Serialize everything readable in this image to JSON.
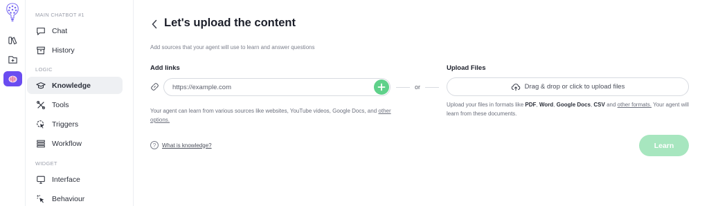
{
  "rail": {
    "icons": [
      "brain-logo-icon",
      "library-icon",
      "new-chatbot-icon",
      "brain-icon"
    ],
    "accent": "#6a4cf0"
  },
  "sidebar": {
    "section_main": "MAIN CHATBOT #1",
    "section_logic": "LOGIC",
    "section_widget": "WIDGET",
    "items": [
      {
        "label": "Chat",
        "icon": "chat-bubble-icon",
        "active": false
      },
      {
        "label": "History",
        "icon": "archive-icon",
        "active": false
      },
      {
        "label": "Knowledge",
        "icon": "graduation-cap-icon",
        "active": true
      },
      {
        "label": "Tools",
        "icon": "tools-icon",
        "active": false
      },
      {
        "label": "Triggers",
        "icon": "trigger-icon",
        "active": false
      },
      {
        "label": "Workflow",
        "icon": "workflow-icon",
        "active": false
      },
      {
        "label": "Interface",
        "icon": "monitor-icon",
        "active": false
      },
      {
        "label": "Behaviour",
        "icon": "sparkle-cursor-icon",
        "active": false
      }
    ]
  },
  "main": {
    "title": "Let's upload the content",
    "subtitle": "Add sources that your agent will use to learn and answer questions",
    "links": {
      "title": "Add links",
      "placeholder": "https://example.com",
      "help_text": "Your agent can learn from various sources like websites, YouTube videos, Google Docs, and",
      "help_link": "other options."
    },
    "or_label": "or",
    "upload": {
      "title": "Upload Files",
      "box_label": "Drag & drop or click to upload files",
      "help_prefix": "Upload your files in formats like",
      "formats": [
        "PDF",
        "Word",
        "Google Docs",
        "CSV"
      ],
      "help_and": "and",
      "help_link": "other formats.",
      "help_suffix": "Your agent will learn from these documents."
    },
    "what_link": "What is knowledge?",
    "learn_button": "Learn",
    "colors": {
      "green": "#5fd18a",
      "green_disabled": "#a7e6bf"
    }
  }
}
